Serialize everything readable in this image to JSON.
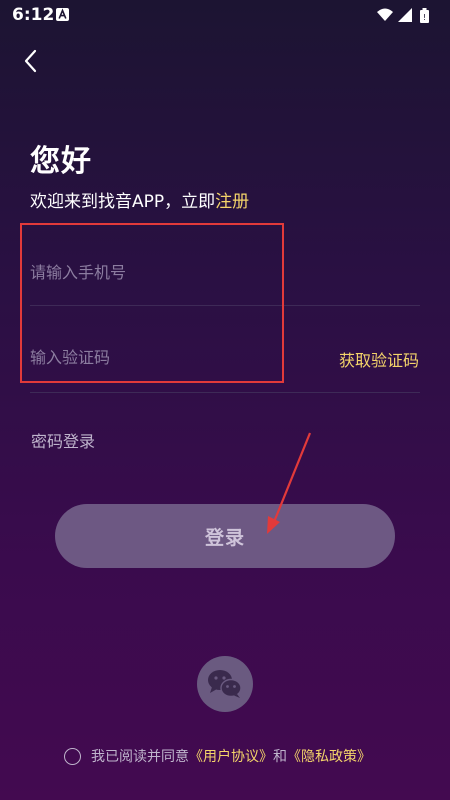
{
  "status_bar": {
    "time": "6:12",
    "icons": [
      "a-notification-icon",
      "wifi-icon",
      "signal-icon",
      "battery-icon"
    ]
  },
  "header": {
    "back_icon": "chevron-left-icon"
  },
  "greeting": "您好",
  "welcome": {
    "text": "欢迎来到找音APP，立即",
    "register_link": "注册"
  },
  "form": {
    "phone_placeholder": "请输入手机号",
    "code_placeholder": "输入验证码",
    "get_code_label": "获取验证码"
  },
  "password_login_label": "密码登录",
  "login_button_label": "登录",
  "wechat_icon": "wechat-icon",
  "agreement": {
    "prefix": "我已阅读并同意",
    "user_agreement": "《用户协议》",
    "and": "和",
    "privacy_policy": "《隐私政策》"
  },
  "colors": {
    "accent_yellow": "#f4d46a",
    "annotation_red": "#e23a3a",
    "button_bg": "#6d5883"
  }
}
